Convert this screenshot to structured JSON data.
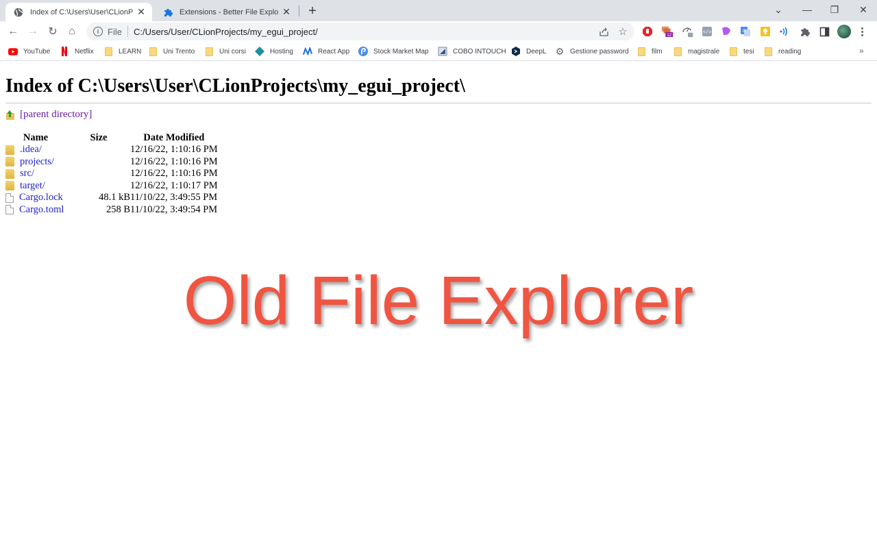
{
  "browser": {
    "tabs": [
      {
        "title": "Index of C:\\Users\\User\\CLionProjects\\my_egui_project\\",
        "icon": "globe-icon",
        "active": true
      },
      {
        "title": "Extensions - Better File Explorer for Chrome",
        "icon": "puzzle-icon",
        "active": false
      }
    ],
    "new_tab_label": "+",
    "window_controls": {
      "tab_search": "⌄",
      "minimize": "—",
      "restore": "❐",
      "close": "✕"
    },
    "nav": {
      "back": "←",
      "forward": "→",
      "reload": "↻",
      "home": "⌂"
    },
    "omnibox": {
      "info": "i",
      "scheme": "File",
      "url": "C:/Users/User/CLionProjects/my_egui_project/"
    },
    "extensions": [
      {
        "name": "adblock-extension",
        "color": "#e8242c"
      },
      {
        "name": "tabs-extension",
        "badge": "12",
        "color": "#e98a5c",
        "badge_color": "#8e1ea6"
      },
      {
        "name": "speed-extension",
        "color": "#5f6368"
      },
      {
        "name": "code-extension",
        "color": "#8c8fa3"
      },
      {
        "name": "purple-extension",
        "color": "#b05cf0"
      },
      {
        "name": "translate-extension",
        "color": "#4c8bf5"
      },
      {
        "name": "keep-extension",
        "color": "#f6c026"
      },
      {
        "name": "wifi-extension",
        "color": "#1a73e8"
      }
    ]
  },
  "bookmarks": [
    {
      "label": "YouTube",
      "icon": "youtube-icon"
    },
    {
      "label": "Netflix",
      "icon": "netflix-icon"
    },
    {
      "label": "LEARN",
      "icon": "folder-icon"
    },
    {
      "label": "Uni Trento",
      "icon": "folder-icon"
    },
    {
      "label": "Uni corsi",
      "icon": "folder-icon"
    },
    {
      "label": "Hosting",
      "icon": "diamond-icon"
    },
    {
      "label": "React App",
      "icon": "react-icon"
    },
    {
      "label": "Stock Market Map",
      "icon": "stock-icon"
    },
    {
      "label": "COBO INTOUCH",
      "icon": "cobo-icon"
    },
    {
      "label": "DeepL",
      "icon": "deepl-icon"
    },
    {
      "label": "Gestione password",
      "icon": "gear-icon"
    },
    {
      "label": "film",
      "icon": "folder-icon"
    },
    {
      "label": "magistrale",
      "icon": "folder-icon"
    },
    {
      "label": "tesi",
      "icon": "folder-icon"
    },
    {
      "label": "reading",
      "icon": "folder-icon"
    }
  ],
  "bookmarks_more": "»",
  "page": {
    "heading": "Index of C:\\Users\\User\\CLionProjects\\my_egui_project\\",
    "parent_link": "[parent directory]",
    "columns": {
      "name": "Name",
      "size": "Size",
      "date": "Date Modified"
    },
    "entries": [
      {
        "name": ".idea/",
        "type": "folder",
        "size": "",
        "date": "12/16/22, 1:10:16 PM"
      },
      {
        "name": "projects/",
        "type": "folder",
        "size": "",
        "date": "12/16/22, 1:10:16 PM"
      },
      {
        "name": "src/",
        "type": "folder",
        "size": "",
        "date": "12/16/22, 1:10:16 PM"
      },
      {
        "name": "target/",
        "type": "folder",
        "size": "",
        "date": "12/16/22, 1:10:17 PM"
      },
      {
        "name": "Cargo.lock",
        "type": "file",
        "size": "48.1 kB",
        "date": "11/10/22, 3:49:55 PM"
      },
      {
        "name": "Cargo.toml",
        "type": "file",
        "size": "258 B",
        "date": "11/10/22, 3:49:54 PM"
      }
    ]
  },
  "overlay_caption": "Old File Explorer",
  "colors": {
    "caption": "#f05542",
    "link": "#2222cc",
    "visited_link": "#681da8"
  }
}
